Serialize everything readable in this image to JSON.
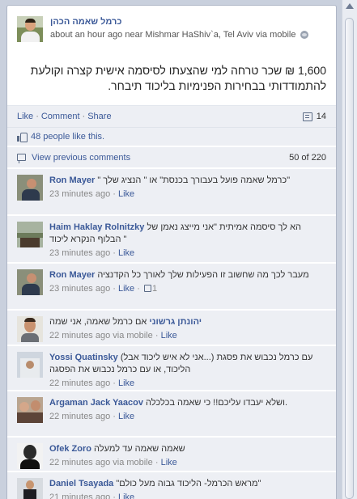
{
  "post": {
    "author": "כרמל שאמה הכהן",
    "meta": "about an hour ago near Mishmar HaShiv`a, Tel Aviv via mobile",
    "body": "1,600 ₪ שכר טרחה למי שהצעתו לסיסמה אישית קצרה וקולעת להתמודדותי בבחירות הפנימיות בליכוד תיבחר.",
    "actions": {
      "like": "Like",
      "comment": "Comment",
      "share": "Share",
      "separator": "·"
    },
    "comment_count": "14",
    "likes_text": "48 people like this.",
    "view_previous": "View previous comments",
    "pagination": "50 of 220"
  },
  "comments": [
    {
      "name": "Ron Mayer",
      "text": "\" כרמל שאמה פועל בעבורך בכנסת\" או \" הנציג שלך\"",
      "time": "23 minutes ago",
      "suffix": "",
      "action": "Like",
      "likes": "",
      "avatar": "ron"
    },
    {
      "name": "Haim Haklay Rolnitzky",
      "text": "הא לך סיסמה אמיתית \"אני מייצג נאמן של הבלוף הנקרא ליכוד \"",
      "time": "23 minutes ago",
      "suffix": "",
      "action": "Like",
      "likes": "",
      "avatar": "haim"
    },
    {
      "name": "Ron Mayer",
      "text": "מעבר לכך מה שחשוב זו הפעילות שלך לאורך כל הקדנציה",
      "time": "23 minutes ago",
      "suffix": "",
      "action": "Like",
      "likes": "1",
      "avatar": "ron"
    },
    {
      "name": "יהונתן גרשוני",
      "text": "אם כרמל שאמה, אני שמה",
      "time": "22 minutes ago",
      "suffix": "via mobile",
      "action": "Like",
      "likes": "",
      "avatar": "yehonatan"
    },
    {
      "name": "Yossi Quatinsky",
      "text": "(אני לא איש ליכוד אבל...) עם כרמל נכבוש את פסגת הליכוד, או עם כרמל נכבוש את הפסגה",
      "time": "22 minutes ago",
      "suffix": "",
      "action": "Like",
      "likes": "",
      "avatar": "yossi"
    },
    {
      "name": "Argaman Jack Yaacov",
      "text": "ושלא יעבדו עליכם!! כי שאמה בכלכלה.",
      "time": "22 minutes ago",
      "suffix": "",
      "action": "Like",
      "likes": "",
      "avatar": "argaman"
    },
    {
      "name": "Ofek Zoro",
      "text": "שאמה שאמה עד למעלה",
      "time": "22 minutes ago",
      "suffix": "via mobile",
      "action": "Like",
      "likes": "",
      "avatar": "ofek"
    },
    {
      "name": "Daniel Tsayada",
      "text": "\"מראש הכרמל- הליכוד גבוה מעל כולם\"",
      "time": "21 minutes ago",
      "suffix": "",
      "action": "Like",
      "likes": "",
      "avatar": "daniel"
    }
  ]
}
